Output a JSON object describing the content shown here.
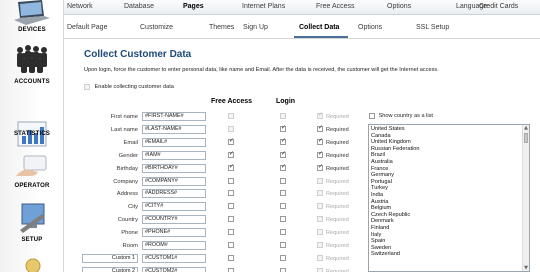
{
  "sidebar": {
    "items": [
      {
        "label": "DEVICES",
        "icon": "laptop-icon"
      },
      {
        "label": "ACCOUNTS",
        "icon": "people-icon"
      },
      {
        "label": "STATISTICS",
        "icon": "chart-icon"
      },
      {
        "label": "OPERATOR",
        "icon": "hand-card-icon"
      },
      {
        "label": "SETUP",
        "icon": "monitor-icon"
      }
    ]
  },
  "topnav": {
    "items": [
      "Network",
      "Database",
      "Pages",
      "Internet Plans",
      "Free Access",
      "Options",
      "Language",
      "Credit Cards"
    ],
    "active": "Pages"
  },
  "subnav": {
    "items": [
      "Default Page",
      "Customize",
      "Themes",
      "Sign Up",
      "Collect Data",
      "Options",
      "SSL Setup"
    ],
    "active": "Collect Data"
  },
  "page": {
    "title": "Collect Customer Data",
    "description": "Upon login, force the customer to enter personal data, like name and Email. After the data is received, the customer will get the Internet access.",
    "enable_label": "Enable collecting customer data",
    "col_free_access": "Free Access",
    "col_login": "Login",
    "required_label": "Required",
    "show_country_list": "Show country as a list"
  },
  "fields": [
    {
      "label": "First name",
      "value": "#FIRST-NAME#",
      "fa": false,
      "fa_dis": true,
      "login": false,
      "login_dis": true,
      "req": true,
      "req_dis": true
    },
    {
      "label": "Last name",
      "value": "#LAST-NAME#",
      "fa": false,
      "fa_dis": true,
      "login": true,
      "login_dis": false,
      "req": true,
      "req_dis": false
    },
    {
      "label": "Email",
      "value": "#EMAIL#",
      "fa": true,
      "fa_dis": false,
      "login": true,
      "login_dis": false,
      "req": true,
      "req_dis": false
    },
    {
      "label": "Gender",
      "value": "#IAM#",
      "fa": true,
      "fa_dis": false,
      "login": true,
      "login_dis": false,
      "req": true,
      "req_dis": false
    },
    {
      "label": "Birthday",
      "value": "#BIRTHDAY#",
      "fa": true,
      "fa_dis": false,
      "login": true,
      "login_dis": false,
      "req": true,
      "req_dis": false
    },
    {
      "label": "Company",
      "value": "#COMPANY#",
      "fa": false,
      "fa_dis": false,
      "login": false,
      "login_dis": false,
      "req": false,
      "req_dis": true
    },
    {
      "label": "Address",
      "value": "#ADDRESS#",
      "fa": false,
      "fa_dis": false,
      "login": false,
      "login_dis": false,
      "req": false,
      "req_dis": true
    },
    {
      "label": "City",
      "value": "#CITY#",
      "fa": false,
      "fa_dis": false,
      "login": false,
      "login_dis": false,
      "req": false,
      "req_dis": true
    },
    {
      "label": "Country",
      "value": "#COUNTRY#",
      "fa": false,
      "fa_dis": false,
      "login": false,
      "login_dis": false,
      "req": false,
      "req_dis": true
    },
    {
      "label": "Phone",
      "value": "#PHONE#",
      "fa": false,
      "fa_dis": false,
      "login": false,
      "login_dis": false,
      "req": false,
      "req_dis": true
    },
    {
      "label": "Room",
      "value": "#ROOM#",
      "fa": false,
      "fa_dis": false,
      "login": false,
      "login_dis": false,
      "req": false,
      "req_dis": true
    },
    {
      "label": "Custom 1",
      "value": "#CUSTOM1#",
      "custom": true,
      "fa": false,
      "fa_dis": false,
      "login": false,
      "login_dis": false,
      "req": false,
      "req_dis": true
    },
    {
      "label": "Custom 2",
      "value": "#CUSTOM2#",
      "custom": true,
      "fa": false,
      "fa_dis": false,
      "login": false,
      "login_dis": false,
      "req": false,
      "req_dis": true
    }
  ],
  "countries": [
    "United States",
    "Canada",
    "United Kingdom",
    "Russian Federation",
    "Brazil",
    "Australia",
    "France",
    "Germany",
    "Portugal",
    "Turkey",
    "India",
    "Austria",
    "Belgium",
    "Czech Republic",
    "Denmark",
    "Finland",
    "Italy",
    "Spain",
    "Sweden",
    "Switzerland"
  ]
}
